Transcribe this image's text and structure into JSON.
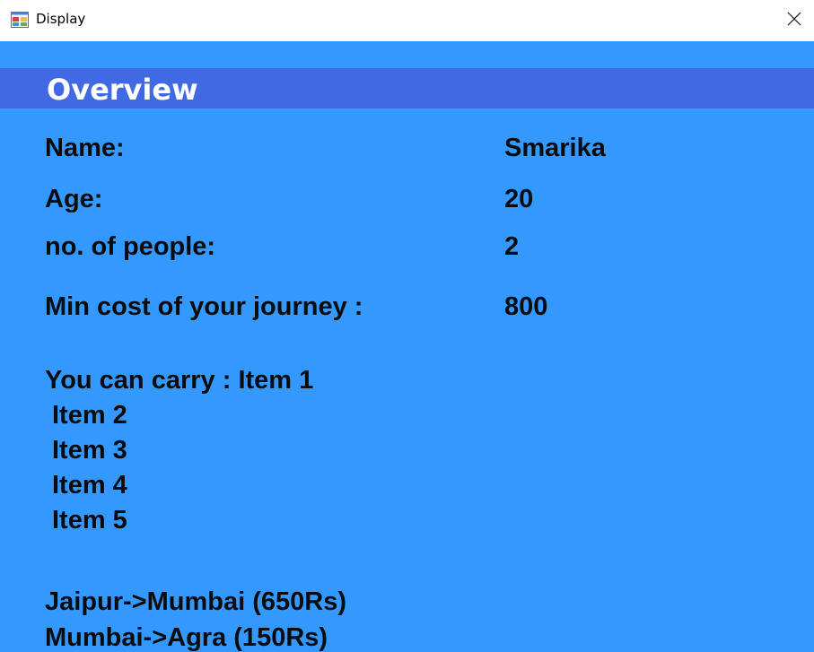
{
  "window": {
    "title": "Display",
    "app_icon": "app-window-icon",
    "close_icon": "close-icon"
  },
  "overview": {
    "heading": "Overview",
    "name_label": "Name:",
    "name_value": "Smarika",
    "age_label": "Age:",
    "age_value": "20",
    "people_label": "no. of people:",
    "people_value": "2",
    "cost_label": "Min cost of your journey :",
    "cost_value": "800",
    "carry_prefix": "You can carry : ",
    "carry_items": [
      "Item 1",
      "Item 2",
      "Item 3",
      "Item 4",
      "Item 5"
    ],
    "routes": [
      "Jaipur->Mumbai (650Rs)",
      "Mumbai->Agra (150Rs)"
    ]
  },
  "colors": {
    "background": "#3399ff",
    "header_band": "#4169e1",
    "heading_text": "#ffffff",
    "body_text": "#0b0b0b"
  }
}
